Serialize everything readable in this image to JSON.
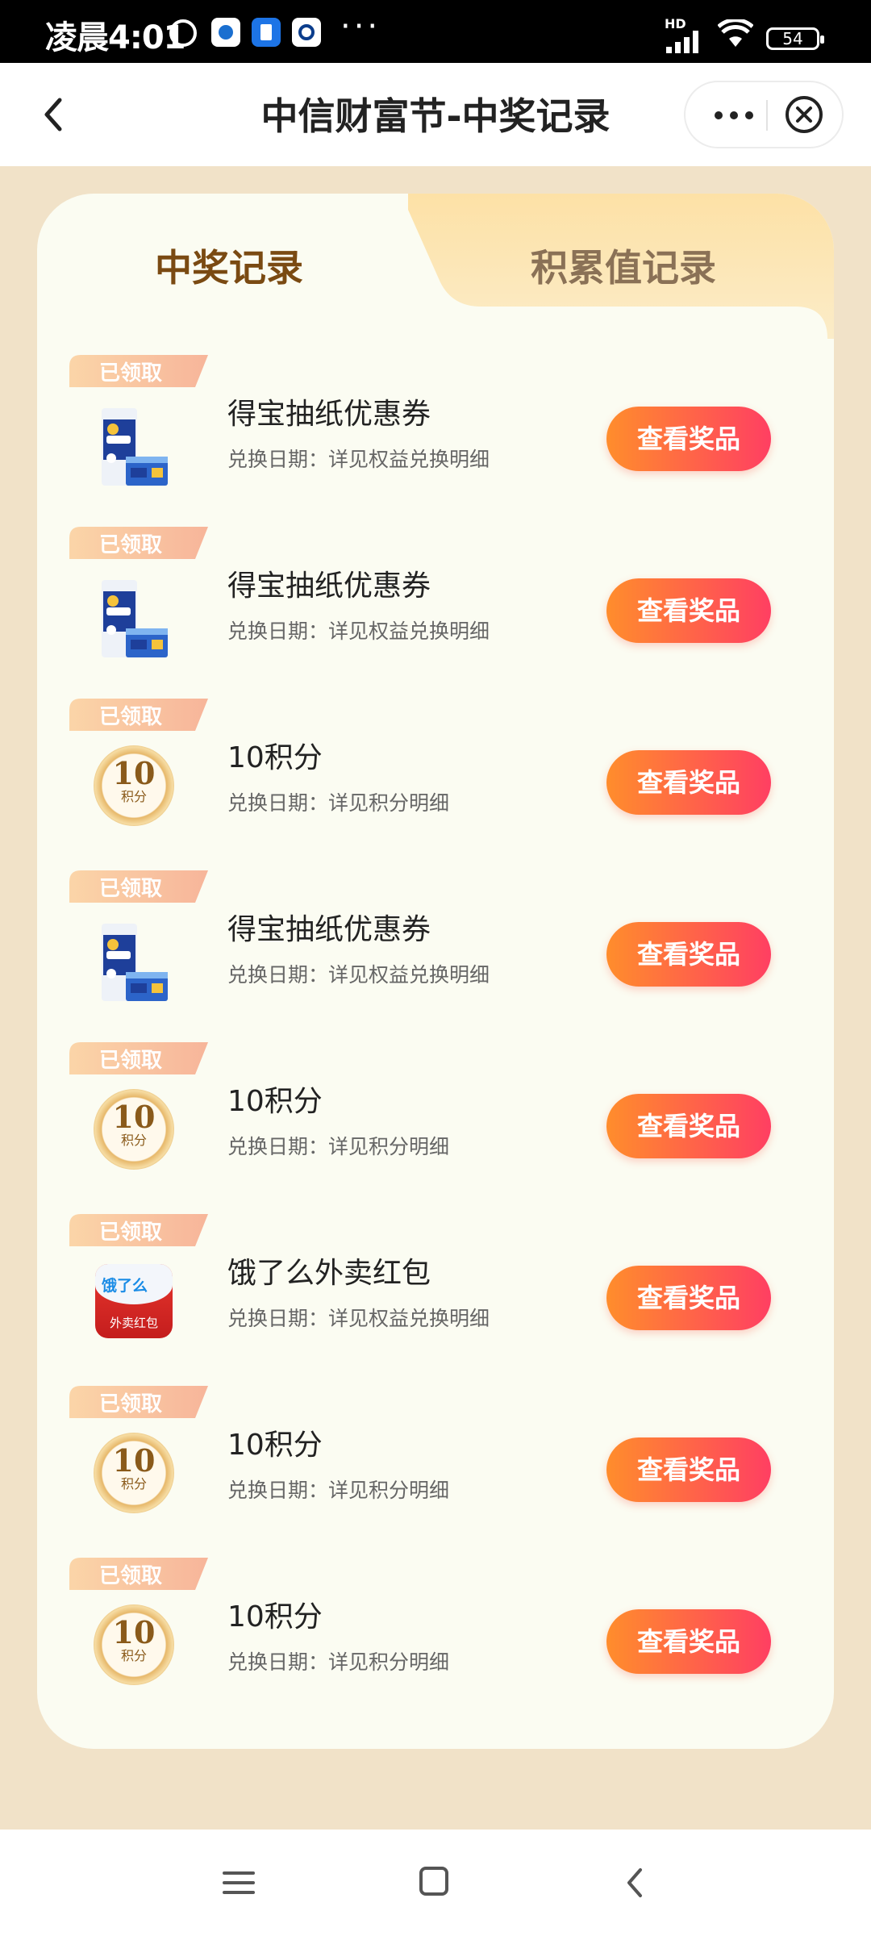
{
  "status_bar": {
    "time": "凌晨4:01",
    "more": "···",
    "network": "HD",
    "battery": "54"
  },
  "nav": {
    "title": "中信财富节-中奖记录"
  },
  "tabs": [
    {
      "label": "中奖记录",
      "active": true
    },
    {
      "label": "积累值记录",
      "active": false
    }
  ],
  "records": [
    {
      "badge": "已领取",
      "name": "得宝抽纸优惠券",
      "date": "兑换日期：详见权益兑换明细",
      "button": "查看奖品",
      "icon": "tissue-pack-icon"
    },
    {
      "badge": "已领取",
      "name": "得宝抽纸优惠券",
      "date": "兑换日期：详见权益兑换明细",
      "button": "查看奖品",
      "icon": "tissue-pack-icon"
    },
    {
      "badge": "已领取",
      "name": "10积分",
      "date": "兑换日期：详见积分明细",
      "button": "查看奖品",
      "icon": "points-coin-icon",
      "coin_value": "10",
      "coin_label": "积分"
    },
    {
      "badge": "已领取",
      "name": "得宝抽纸优惠券",
      "date": "兑换日期：详见权益兑换明细",
      "button": "查看奖品",
      "icon": "tissue-pack-icon"
    },
    {
      "badge": "已领取",
      "name": "10积分",
      "date": "兑换日期：详见积分明细",
      "button": "查看奖品",
      "icon": "points-coin-icon",
      "coin_value": "10",
      "coin_label": "积分"
    },
    {
      "badge": "已领取",
      "name": "饿了么外卖红包",
      "date": "兑换日期：详见权益兑换明细",
      "button": "查看奖品",
      "icon": "red-packet-icon",
      "brand": "饿了么",
      "packet_label": "外卖红包"
    },
    {
      "badge": "已领取",
      "name": "10积分",
      "date": "兑换日期：详见积分明细",
      "button": "查看奖品",
      "icon": "points-coin-icon",
      "coin_value": "10",
      "coin_label": "积分"
    },
    {
      "badge": "已领取",
      "name": "10积分",
      "date": "兑换日期：详见积分明细",
      "button": "查看奖品",
      "icon": "points-coin-icon",
      "coin_value": "10",
      "coin_label": "积分"
    }
  ],
  "colors": {
    "page_bg": "#f1e2c8",
    "card_bg": "#fbfcf2",
    "button_gradient_start": "#ff8d2c",
    "button_gradient_end": "#ff3f62",
    "active_tab_text": "#7a4a12",
    "badge_start": "#fbd5a8",
    "badge_end": "#f7b59a"
  }
}
